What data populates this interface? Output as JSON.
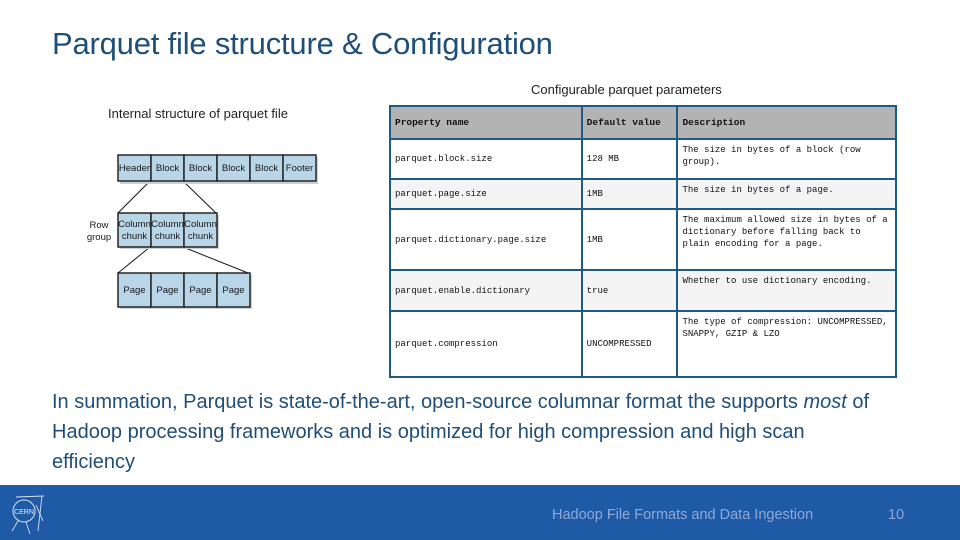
{
  "slide": {
    "title": "Parquet file structure & Configuration",
    "table_caption": "Configurable parquet parameters",
    "diagram_caption": "Internal structure of parquet file"
  },
  "diagram": {
    "file_row": [
      "Header",
      "Block",
      "Block",
      "Block",
      "Block",
      "Footer"
    ],
    "row_group_label_line1": "Row",
    "row_group_label_line2": "group",
    "column_chunks": [
      {
        "line1": "Column",
        "line2": "chunk"
      },
      {
        "line1": "Column",
        "line2": "chunk"
      },
      {
        "line1": "Column",
        "line2": "chunk"
      }
    ],
    "pages": [
      "Page",
      "Page",
      "Page",
      "Page"
    ]
  },
  "table": {
    "headers": [
      "Property name",
      "Default value",
      "Description"
    ],
    "rows": [
      {
        "name": "parquet.block.size",
        "default": "128 MB",
        "description": "The size in bytes of a block (row group)."
      },
      {
        "name": "parquet.page.size",
        "default": "1MB",
        "description": "The size in bytes of a page."
      },
      {
        "name": "parquet.dictionary.page.size",
        "default": "1MB",
        "description": "The maximum allowed size in bytes of a dictionary before falling back to plain encoding for a page."
      },
      {
        "name": "parquet.enable.dictionary",
        "default": "true",
        "description": "Whether to use dictionary encoding."
      },
      {
        "name": "parquet.compression",
        "default": "UNCOMPRESSED",
        "description": "The type of compression: UNCOMPRESSED, SNAPPY, GZIP & LZO"
      }
    ]
  },
  "summary": {
    "part1": "In summation, Parquet is state-of-the-art, open-source columnar format the supports ",
    "emphasis": "most",
    "part2": " of Hadoop processing frameworks and is optimized for high compression and high scan efficiency"
  },
  "footer": {
    "logo_text": "CERN",
    "title": "Hadoop File Formats and Data Ingestion",
    "page_number": "10"
  },
  "colors": {
    "title": "#1f4e79",
    "footer_bg": "#1f5aa6",
    "table_border": "#1f5a85",
    "table_header_bg": "#b3b3b3",
    "diagram_box": "#b9d5e8"
  }
}
